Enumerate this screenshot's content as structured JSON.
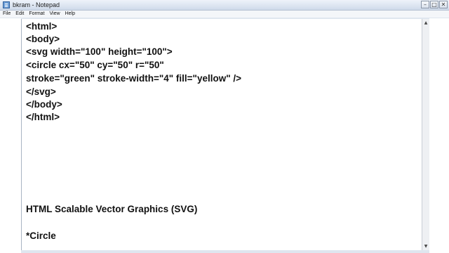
{
  "window": {
    "title": "bkram - Notepad",
    "controls": [
      "minimize-icon",
      "maximize-icon",
      "close-icon"
    ]
  },
  "menu": {
    "items": [
      "File",
      "Edit",
      "Format",
      "View",
      "Help"
    ]
  },
  "editor": {
    "lines": [
      "<html>",
      "<body>",
      "<svg width=\"100\" height=\"100\">",
      "<circle cx=\"50\" cy=\"50\" r=\"50\"",
      "stroke=\"green\" stroke-width=\"4\" fill=\"yellow\" />",
      "</svg>",
      "</body>",
      "</html>"
    ],
    "heading": "HTML Scalable Vector Graphics (SVG)",
    "topic": "*Circle"
  },
  "scrollbar": {
    "up_icon": "scroll-up-icon",
    "down_icon": "scroll-down-icon"
  }
}
